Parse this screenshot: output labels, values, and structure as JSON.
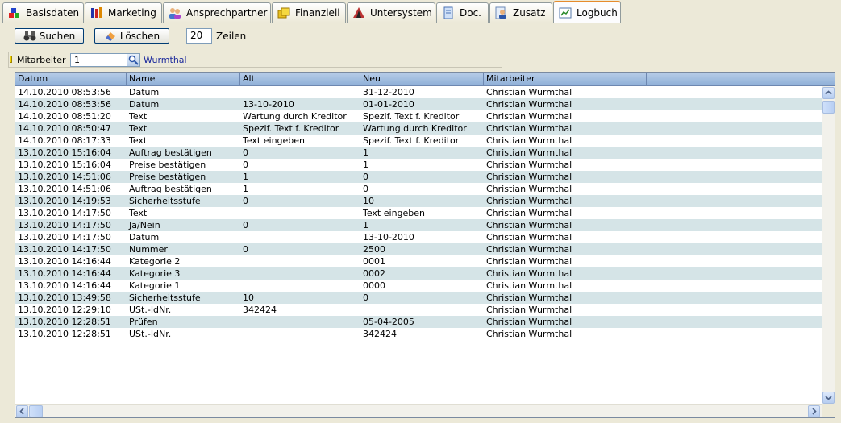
{
  "tabs": [
    {
      "id": "basisdaten",
      "label": "Basisdaten",
      "icon": "blocks-icon"
    },
    {
      "id": "marketing",
      "label": "Marketing",
      "icon": "books-icon"
    },
    {
      "id": "ansprechpartner",
      "label": "Ansprechpartner",
      "icon": "people-icon"
    },
    {
      "id": "finanziell",
      "label": "Finanziell",
      "icon": "money-icon"
    },
    {
      "id": "untersystem",
      "label": "Untersystem",
      "icon": "tent-icon"
    },
    {
      "id": "doc",
      "label": "Doc.",
      "icon": "document-icon"
    },
    {
      "id": "zusatz",
      "label": "Zusatz",
      "icon": "person-extra-icon"
    },
    {
      "id": "logbuch",
      "label": "Logbuch",
      "icon": "chart-icon",
      "active": true
    }
  ],
  "toolbar": {
    "search_label": "Suchen",
    "delete_label": "Löschen",
    "rows_value": "20",
    "rows_label": "Zeilen"
  },
  "filter": {
    "label": "Mitarbeiter",
    "value": "1",
    "resolved_name": "Wurmthal"
  },
  "grid": {
    "columns": [
      "Datum",
      "Name",
      "Alt",
      "Neu",
      "Mitarbeiter"
    ],
    "rows": [
      [
        "14.10.2010 08:53:56",
        "Datum",
        "",
        "31-12-2010",
        "Christian Wurmthal"
      ],
      [
        "14.10.2010 08:53:56",
        "Datum",
        "13-10-2010",
        "01-01-2010",
        "Christian Wurmthal"
      ],
      [
        "14.10.2010 08:51:20",
        "Text",
        "Wartung durch Kreditor",
        "Spezif. Text f. Kreditor",
        "Christian Wurmthal"
      ],
      [
        "14.10.2010 08:50:47",
        "Text",
        "Spezif. Text f. Kreditor",
        "Wartung durch Kreditor",
        "Christian Wurmthal"
      ],
      [
        "14.10.2010 08:17:33",
        "Text",
        "Text eingeben",
        "Spezif. Text f. Kreditor",
        "Christian Wurmthal"
      ],
      [
        "13.10.2010 15:16:04",
        "Auftrag bestätigen",
        "0",
        "1",
        "Christian Wurmthal"
      ],
      [
        "13.10.2010 15:16:04",
        "Preise bestätigen",
        "0",
        "1",
        "Christian Wurmthal"
      ],
      [
        "13.10.2010 14:51:06",
        "Preise bestätigen",
        "1",
        "0",
        "Christian Wurmthal"
      ],
      [
        "13.10.2010 14:51:06",
        "Auftrag bestätigen",
        "1",
        "0",
        "Christian Wurmthal"
      ],
      [
        "13.10.2010 14:19:53",
        "Sicherheitsstufe",
        "0",
        "10",
        "Christian Wurmthal"
      ],
      [
        "13.10.2010 14:17:50",
        "Text",
        "",
        "Text eingeben",
        "Christian Wurmthal"
      ],
      [
        "13.10.2010 14:17:50",
        "Ja/Nein",
        "0",
        "1",
        "Christian Wurmthal"
      ],
      [
        "13.10.2010 14:17:50",
        "Datum",
        "",
        "13-10-2010",
        "Christian Wurmthal"
      ],
      [
        "13.10.2010 14:17:50",
        "Nummer",
        "0",
        "2500",
        "Christian Wurmthal"
      ],
      [
        "13.10.2010 14:16:44",
        "Kategorie 2",
        "",
        "0001",
        "Christian Wurmthal"
      ],
      [
        "13.10.2010 14:16:44",
        "Kategorie 3",
        "",
        "0002",
        "Christian Wurmthal"
      ],
      [
        "13.10.2010 14:16:44",
        "Kategorie 1",
        "",
        "0000",
        "Christian Wurmthal"
      ],
      [
        "13.10.2010 13:49:58",
        "Sicherheitsstufe",
        "10",
        "0",
        "Christian Wurmthal"
      ],
      [
        "13.10.2010 12:29:10",
        "USt.-IdNr.",
        "342424",
        "",
        "Christian Wurmthal"
      ],
      [
        "13.10.2010 12:28:51",
        "Prüfen",
        "",
        "05-04-2005",
        "Christian Wurmthal"
      ],
      [
        "13.10.2010 12:28:51",
        "USt.-IdNr.",
        "",
        "342424",
        "Christian Wurmthal"
      ]
    ]
  },
  "colors": {
    "background": "#ece9d8",
    "header": "#a4c0e4",
    "row_alt": "#d5e4e7",
    "active_tab_accent": "#e68b2c",
    "link_text": "#1c2a9c"
  }
}
